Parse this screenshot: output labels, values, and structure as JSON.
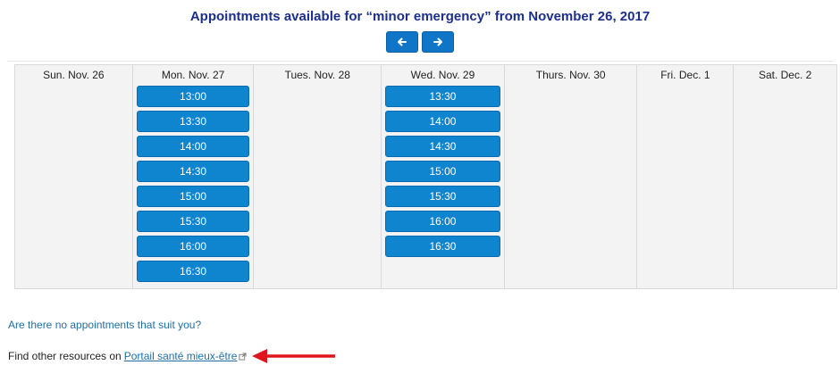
{
  "header": {
    "title": "Appointments available for “minor emergency” from November 26, 2017"
  },
  "nav": {
    "prev_icon": "arrow-left-icon",
    "next_icon": "arrow-right-icon"
  },
  "calendar": {
    "days": [
      {
        "label": "Sun. Nov. 26",
        "slots": []
      },
      {
        "label": "Mon. Nov. 27",
        "slots": [
          "13:00",
          "13:30",
          "14:00",
          "14:30",
          "15:00",
          "15:30",
          "16:00",
          "16:30"
        ]
      },
      {
        "label": "Tues. Nov. 28",
        "slots": []
      },
      {
        "label": "Wed. Nov. 29",
        "slots": [
          "13:30",
          "14:00",
          "14:30",
          "15:00",
          "15:30",
          "16:00",
          "16:30"
        ]
      },
      {
        "label": "Thurs. Nov. 30",
        "slots": []
      },
      {
        "label": "Fri. Dec. 1",
        "slots": []
      },
      {
        "label": "Sat. Dec. 2",
        "slots": []
      }
    ]
  },
  "footer": {
    "no_appointments_link": "Are there no appointments that suit you?",
    "resources_prefix": "Find other resources on",
    "portal_link": "Portail santé mieux-être",
    "portal_icon": "external-link-icon"
  },
  "colors": {
    "title": "#1c2f8a",
    "slot_button": "#0f85d0",
    "annotation_arrow": "#e0141b"
  }
}
